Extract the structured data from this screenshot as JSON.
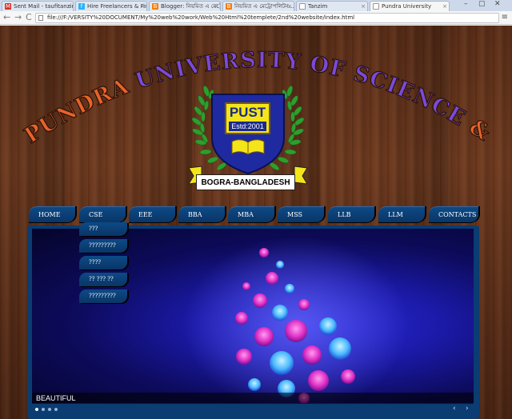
{
  "browser": {
    "tabs": [
      {
        "label": "Sent Mail - taufitanzim2...",
        "icon": "gmail-icon",
        "color": "#d93025"
      },
      {
        "label": "Hire Freelancers & Find Fr...",
        "icon": "freelancer-icon",
        "color": "#29b2fe"
      },
      {
        "label": "Blogger: নিয়মিত এ মেট্রোপ...",
        "icon": "blogger-icon",
        "color": "#f57d00"
      },
      {
        "label": "নিয়মিত এ মেট্রোপলিটন...",
        "icon": "blogger-icon",
        "color": "#f57d00"
      },
      {
        "label": "Tanzim",
        "icon": "page-icon",
        "color": "#888888"
      },
      {
        "label": "Pundra University",
        "icon": "page-icon",
        "color": "#888888"
      }
    ],
    "url": "file:///F:/VERSITY%20DOCUMENT/My%20web%20work/Web%20Html%20templete/2nd%20website/index.html",
    "window_controls": [
      "–",
      "▢",
      "✕"
    ],
    "tab_close": "×",
    "nav": {
      "back": "←",
      "forward": "→",
      "reload": "C"
    },
    "menu": "≡"
  },
  "banner": {
    "university_name": "PUNDRA UNIVERSITY OF SCIENCE & TECHNOLOGY",
    "logo_title": "PUST",
    "logo_estd": "Estd:2001",
    "location": "BOGRA-BANGLADESH",
    "colors": {
      "arc_orange": "#e8622a",
      "arc_purple": "#7a4ad8",
      "shield": "#1f2aa0",
      "laurel": "#2e9e2e"
    }
  },
  "nav": {
    "items": [
      "HOME",
      "CSE",
      "EEE",
      "BBA",
      "MBA",
      "MSS",
      "LLB",
      "LLM",
      "CONTACTS"
    ]
  },
  "dropdown": {
    "items": [
      "???",
      "?????????",
      "????",
      "?? ??? ??",
      "?????????"
    ]
  },
  "slider": {
    "caption": "BEAUTIFUL",
    "slide_count": 4,
    "active_slide": 1,
    "prev": "‹",
    "next": "›"
  }
}
